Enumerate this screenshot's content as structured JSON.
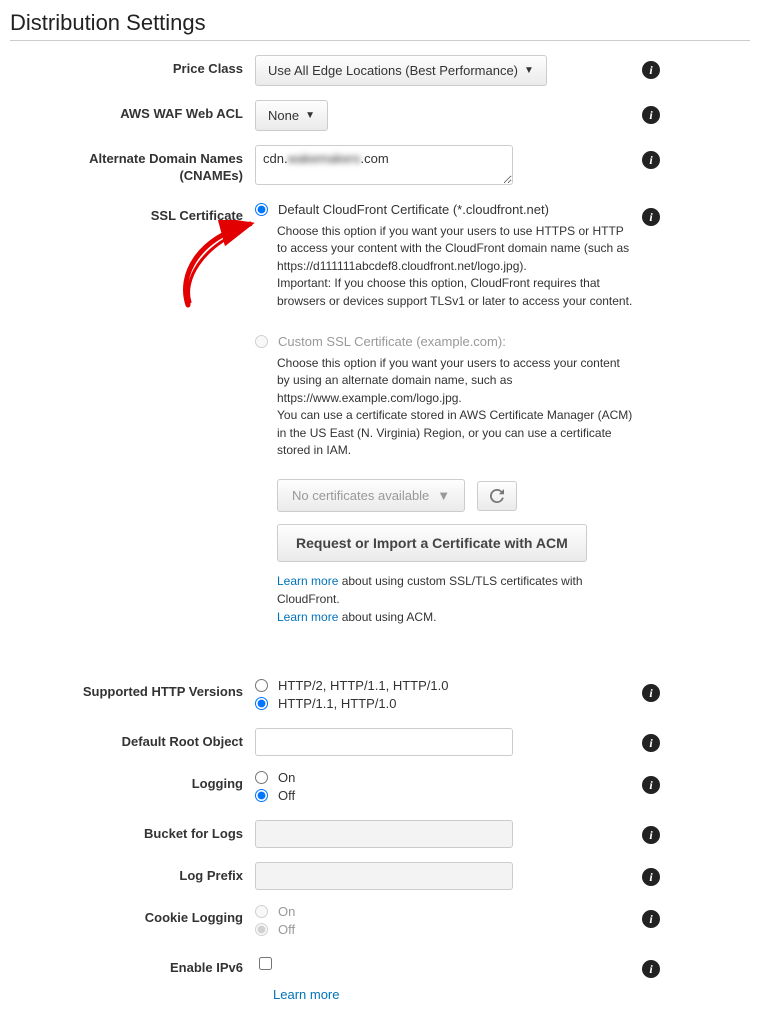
{
  "page_title": "Distribution Settings",
  "labels": {
    "price_class": "Price Class",
    "waf": "AWS WAF Web ACL",
    "cnames_l1": "Alternate Domain Names",
    "cnames_l2": "(CNAMEs)",
    "ssl": "SSL Certificate",
    "http_versions": "Supported HTTP Versions",
    "root_object": "Default Root Object",
    "logging": "Logging",
    "bucket_logs": "Bucket for Logs",
    "log_prefix": "Log Prefix",
    "cookie_logging": "Cookie Logging",
    "ipv6": "Enable IPv6"
  },
  "price_class": {
    "value": "Use All Edge Locations (Best Performance)"
  },
  "waf": {
    "value": "None"
  },
  "cnames": {
    "prefix": "cdn.",
    "blurred": "wakemakers",
    "suffix": ".com"
  },
  "ssl": {
    "default_label": "Default CloudFront Certificate (*.cloudfront.net)",
    "default_help_1": "Choose this option if you want your users to use HTTPS or HTTP to access your content with the CloudFront domain name (such as https://d111111abcdef8.cloudfront.net/logo.jpg).",
    "default_help_2": "Important: If you choose this option, CloudFront requires that browsers or devices support TLSv1 or later to access your content.",
    "custom_label": "Custom SSL Certificate (example.com):",
    "custom_help_1": "Choose this option if you want your users to access your content by using an alternate domain name, such as https://www.example.com/logo.jpg.",
    "custom_help_2": "You can use a certificate stored in AWS Certificate Manager (ACM) in the US East (N. Virginia) Region, or you can use a certificate stored in IAM.",
    "cert_dropdown": "No certificates available",
    "request_btn": "Request or Import a Certificate with ACM",
    "learn_more": "Learn more",
    "learn_more_1_tail": " about using custom SSL/TLS certificates with CloudFront.",
    "learn_more_2_tail": " about using ACM."
  },
  "http_versions": {
    "opt1": "HTTP/2, HTTP/1.1, HTTP/1.0",
    "opt2": "HTTP/1.1, HTTP/1.0"
  },
  "logging": {
    "on": "On",
    "off": "Off"
  },
  "cookie_logging": {
    "on": "On",
    "off": "Off"
  },
  "ipv6": {
    "learn_more": "Learn more"
  }
}
